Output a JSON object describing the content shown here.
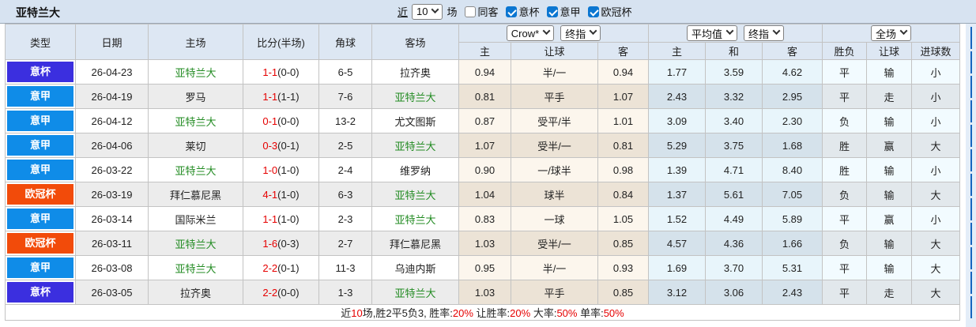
{
  "topbar": {
    "title": "亚特兰大",
    "recent_label": "近",
    "count_value": "10",
    "games_label": "场",
    "filters": [
      {
        "label": "同客",
        "state": ""
      },
      {
        "label": "意杯",
        "state": "checked"
      },
      {
        "label": "意甲",
        "state": "checked"
      },
      {
        "label": "欧冠杯",
        "state": "checked"
      }
    ]
  },
  "selects": {
    "crown": "Crow*",
    "crown_time": "终指",
    "avg": "平均值",
    "avg_time": "终指",
    "scope": "全场"
  },
  "colors": {
    "italy_cup": "#3b2fdf",
    "serie_a": "#0f8ce8",
    "ucl": "#f24b0a",
    "highlight_team": "#228b22",
    "score": "#e60000"
  },
  "table": {
    "columns": [
      "类型",
      "日期",
      "主场",
      "比分(半场)",
      "角球",
      "客场"
    ],
    "sub_columns": [
      "主",
      "让球",
      "客",
      "主",
      "和",
      "客",
      "胜负",
      "让球",
      "进球数"
    ],
    "rows": [
      {
        "league": {
          "label": "意杯",
          "color": "#3b2fdf"
        },
        "date": "26-04-23",
        "home": {
          "name": "亚特兰大",
          "cls": "hl"
        },
        "score": {
          "ft": "1-1",
          "ht": "(0-0)"
        },
        "corner": "6-5",
        "away": {
          "name": "拉齐奥",
          "cls": ""
        },
        "crown": {
          "h": "0.94",
          "hcap": "半/一",
          "a": "0.94"
        },
        "avg": {
          "h": "1.77",
          "d": "3.59",
          "a": "4.62"
        },
        "res": {
          "wdl": {
            "t": "平",
            "cls": "green"
          },
          "hcap": {
            "t": "输",
            "cls": "blue"
          },
          "goals": {
            "t": "小",
            "cls": "blue"
          }
        }
      },
      {
        "league": {
          "label": "意甲",
          "color": "#0f8ce8"
        },
        "date": "26-04-19",
        "home": {
          "name": "罗马",
          "cls": ""
        },
        "score": {
          "ft": "1-1",
          "ht": "(1-1)"
        },
        "corner": "7-6",
        "away": {
          "name": "亚特兰大",
          "cls": "hl"
        },
        "crown": {
          "h": "0.81",
          "hcap": "平手",
          "a": "1.07"
        },
        "avg": {
          "h": "2.43",
          "d": "3.32",
          "a": "2.95"
        },
        "res": {
          "wdl": {
            "t": "平",
            "cls": "green"
          },
          "hcap": {
            "t": "走",
            "cls": "green"
          },
          "goals": {
            "t": "小",
            "cls": "blue"
          }
        }
      },
      {
        "league": {
          "label": "意甲",
          "color": "#0f8ce8"
        },
        "date": "26-04-12",
        "home": {
          "name": "亚特兰大",
          "cls": "hl"
        },
        "score": {
          "ft": "0-1",
          "ht": "(0-0)"
        },
        "corner": "13-2",
        "away": {
          "name": "尤文图斯",
          "cls": ""
        },
        "crown": {
          "h": "0.87",
          "hcap": "受平/半",
          "a": "1.01"
        },
        "avg": {
          "h": "3.09",
          "d": "3.40",
          "a": "2.30"
        },
        "res": {
          "wdl": {
            "t": "负",
            "cls": "blue"
          },
          "hcap": {
            "t": "输",
            "cls": "blue"
          },
          "goals": {
            "t": "小",
            "cls": "blue"
          }
        }
      },
      {
        "league": {
          "label": "意甲",
          "color": "#0f8ce8"
        },
        "date": "26-04-06",
        "home": {
          "name": "莱切",
          "cls": ""
        },
        "score": {
          "ft": "0-3",
          "ht": "(0-1)"
        },
        "corner": "2-5",
        "away": {
          "name": "亚特兰大",
          "cls": "hl"
        },
        "crown": {
          "h": "1.07",
          "hcap": "受半/一",
          "a": "0.81"
        },
        "avg": {
          "h": "5.29",
          "d": "3.75",
          "a": "1.68"
        },
        "res": {
          "wdl": {
            "t": "胜",
            "cls": "red"
          },
          "hcap": {
            "t": "赢",
            "cls": "red"
          },
          "goals": {
            "t": "大",
            "cls": "red"
          }
        }
      },
      {
        "league": {
          "label": "意甲",
          "color": "#0f8ce8"
        },
        "date": "26-03-22",
        "home": {
          "name": "亚特兰大",
          "cls": "hl"
        },
        "score": {
          "ft": "1-0",
          "ht": "(1-0)"
        },
        "corner": "2-4",
        "away": {
          "name": "维罗纳",
          "cls": ""
        },
        "crown": {
          "h": "0.90",
          "hcap": "一/球半",
          "a": "0.98"
        },
        "avg": {
          "h": "1.39",
          "d": "4.71",
          "a": "8.40"
        },
        "res": {
          "wdl": {
            "t": "胜",
            "cls": "red"
          },
          "hcap": {
            "t": "输",
            "cls": "blue"
          },
          "goals": {
            "t": "小",
            "cls": "blue"
          }
        }
      },
      {
        "league": {
          "label": "欧冠杯",
          "color": "#f24b0a"
        },
        "date": "26-03-19",
        "home": {
          "name": "拜仁慕尼黑",
          "cls": ""
        },
        "score": {
          "ft": "4-1",
          "ht": "(1-0)"
        },
        "corner": "6-3",
        "away": {
          "name": "亚特兰大",
          "cls": "hl"
        },
        "crown": {
          "h": "1.04",
          "hcap": "球半",
          "a": "0.84"
        },
        "avg": {
          "h": "1.37",
          "d": "5.61",
          "a": "7.05"
        },
        "res": {
          "wdl": {
            "t": "负",
            "cls": "blue"
          },
          "hcap": {
            "t": "输",
            "cls": "blue"
          },
          "goals": {
            "t": "大",
            "cls": "red"
          }
        }
      },
      {
        "league": {
          "label": "意甲",
          "color": "#0f8ce8"
        },
        "date": "26-03-14",
        "home": {
          "name": "国际米兰",
          "cls": ""
        },
        "score": {
          "ft": "1-1",
          "ht": "(1-0)"
        },
        "corner": "2-3",
        "away": {
          "name": "亚特兰大",
          "cls": "hl"
        },
        "crown": {
          "h": "0.83",
          "hcap": "一球",
          "a": "1.05"
        },
        "avg": {
          "h": "1.52",
          "d": "4.49",
          "a": "5.89"
        },
        "res": {
          "wdl": {
            "t": "平",
            "cls": "green"
          },
          "hcap": {
            "t": "赢",
            "cls": "red"
          },
          "goals": {
            "t": "小",
            "cls": "blue"
          }
        }
      },
      {
        "league": {
          "label": "欧冠杯",
          "color": "#f24b0a"
        },
        "date": "26-03-11",
        "home": {
          "name": "亚特兰大",
          "cls": "hl"
        },
        "score": {
          "ft": "1-6",
          "ht": "(0-3)"
        },
        "corner": "2-7",
        "away": {
          "name": "拜仁慕尼黑",
          "cls": ""
        },
        "crown": {
          "h": "1.03",
          "hcap": "受半/一",
          "a": "0.85"
        },
        "avg": {
          "h": "4.57",
          "d": "4.36",
          "a": "1.66"
        },
        "res": {
          "wdl": {
            "t": "负",
            "cls": "blue"
          },
          "hcap": {
            "t": "输",
            "cls": "blue"
          },
          "goals": {
            "t": "大",
            "cls": "red"
          }
        }
      },
      {
        "league": {
          "label": "意甲",
          "color": "#0f8ce8"
        },
        "date": "26-03-08",
        "home": {
          "name": "亚特兰大",
          "cls": "hl"
        },
        "score": {
          "ft": "2-2",
          "ht": "(0-1)"
        },
        "corner": "11-3",
        "away": {
          "name": "乌迪内斯",
          "cls": ""
        },
        "crown": {
          "h": "0.95",
          "hcap": "半/一",
          "a": "0.93"
        },
        "avg": {
          "h": "1.69",
          "d": "3.70",
          "a": "5.31"
        },
        "res": {
          "wdl": {
            "t": "平",
            "cls": "green"
          },
          "hcap": {
            "t": "输",
            "cls": "blue"
          },
          "goals": {
            "t": "大",
            "cls": "red"
          }
        }
      },
      {
        "league": {
          "label": "意杯",
          "color": "#3b2fdf"
        },
        "date": "26-03-05",
        "home": {
          "name": "拉齐奥",
          "cls": ""
        },
        "score": {
          "ft": "2-2",
          "ht": "(0-0)"
        },
        "corner": "1-3",
        "away": {
          "name": "亚特兰大",
          "cls": "hl"
        },
        "crown": {
          "h": "1.03",
          "hcap": "平手",
          "a": "0.85"
        },
        "avg": {
          "h": "3.12",
          "d": "3.06",
          "a": "2.43"
        },
        "res": {
          "wdl": {
            "t": "平",
            "cls": "green"
          },
          "hcap": {
            "t": "走",
            "cls": "green"
          },
          "goals": {
            "t": "大",
            "cls": "red"
          }
        }
      }
    ]
  },
  "footer": {
    "parts": [
      {
        "t": "近",
        "cls": ""
      },
      {
        "t": "10",
        "cls": "red"
      },
      {
        "t": "场,胜2平5负3, 胜率:",
        "cls": ""
      },
      {
        "t": "20%",
        "cls": "red"
      },
      {
        "t": " 让胜率:",
        "cls": ""
      },
      {
        "t": "20%",
        "cls": "red"
      },
      {
        "t": " 大率:",
        "cls": ""
      },
      {
        "t": "50%",
        "cls": "red"
      },
      {
        "t": " 单率:",
        "cls": ""
      },
      {
        "t": "50%",
        "cls": "red"
      }
    ]
  }
}
